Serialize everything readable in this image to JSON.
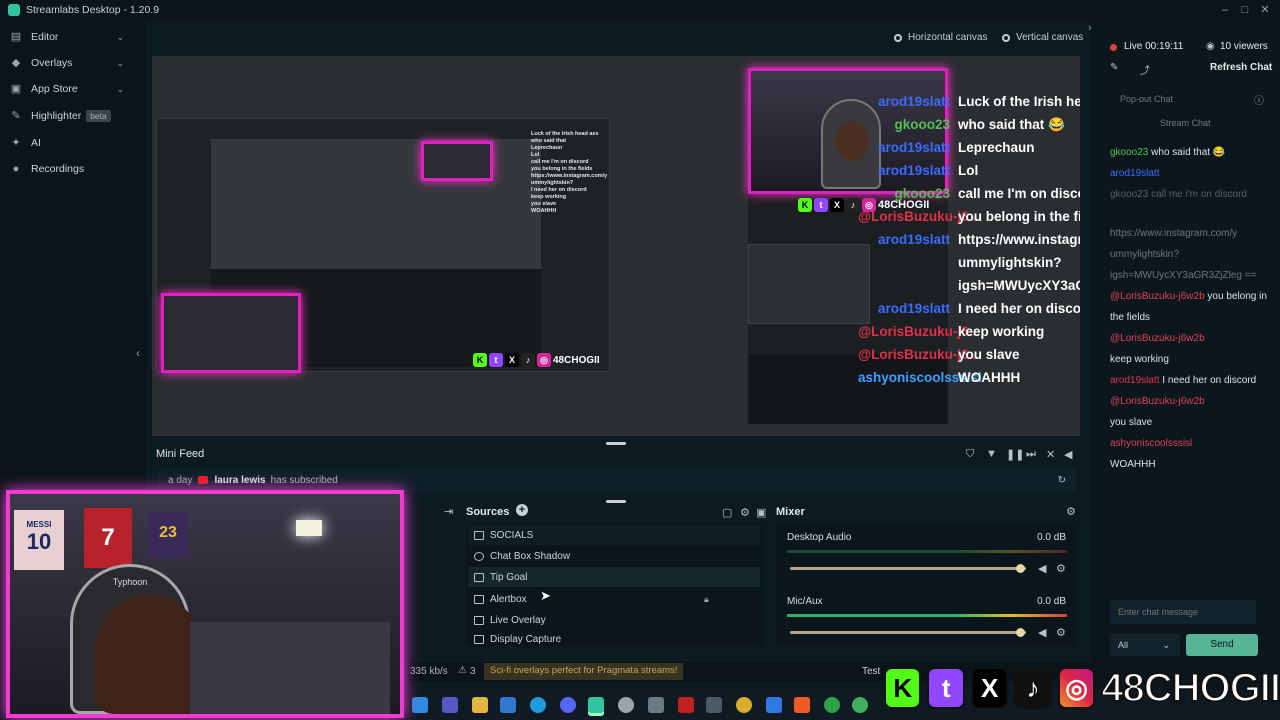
{
  "app": {
    "title": "Streamlabs Desktop - 1.20.9"
  },
  "sidebar": {
    "items": [
      {
        "label": "Editor",
        "icon": "editor-icon",
        "chevron": "⌄"
      },
      {
        "label": "Overlays",
        "icon": "overlays-icon",
        "chevron": "⌄"
      },
      {
        "label": "App Store",
        "icon": "app-store-icon",
        "chevron": "⌄"
      },
      {
        "label": "Highlighter",
        "icon": "highlighter-icon",
        "badge": "beta"
      },
      {
        "label": "AI",
        "icon": "ai-icon"
      },
      {
        "label": "Recordings",
        "icon": "recordings-icon"
      }
    ]
  },
  "canvas": {
    "horizontal": "Horizontal canvas",
    "vertical": "Vertical canvas"
  },
  "overlay_chat": [
    {
      "name": "arod19slatt",
      "color": "#3a6cff",
      "text": "Luck of the Irish head ass"
    },
    {
      "name": "gkooo23",
      "color": "#4fc24f",
      "text": "who said that 😂"
    },
    {
      "name": "arod19slatt",
      "color": "#3a6cff",
      "text": "Leprechaun"
    },
    {
      "name": "arod19slatt",
      "color": "#3a6cff",
      "text": "Lol"
    },
    {
      "name": "gkooo23",
      "color": "#4fc24f",
      "text": "call me I'm on discord"
    },
    {
      "name": "@LorisBuzuku-j6...",
      "color": "#e0304a",
      "text": "you belong in the fields"
    },
    {
      "name": "arod19slatt",
      "color": "#3a6cff",
      "text": "https://www.instagram.com/y"
    },
    {
      "name": "",
      "color": "#3a6cff",
      "text": "ummylightskin?"
    },
    {
      "name": "",
      "color": "#3a6cff",
      "text": "igsh=MWUycXY3aGR3ZjZleg=="
    },
    {
      "name": "arod19slatt",
      "color": "#3a6cff",
      "text": "I need her on discord"
    },
    {
      "name": "@LorisBuzuku-j6...",
      "color": "#e0304a",
      "text": "keep working"
    },
    {
      "name": "@LorisBuzuku-j6...",
      "color": "#e0304a",
      "text": "you slave"
    },
    {
      "name": "ashyoniscoolsssisl",
      "color": "#3aa0ff",
      "text": "WOAHHH"
    }
  ],
  "overlay_social": {
    "handle": "48CHOGII"
  },
  "minifeed": {
    "title": "Mini Feed",
    "time": "a day",
    "user": "laura lewis",
    "action": "has subscribed"
  },
  "sources": {
    "title": "Sources",
    "items": [
      "SOCIALS",
      "Chat Box Shadow",
      "Tip Goal",
      "Alertbox",
      "Live Overlay",
      "Display Capture"
    ]
  },
  "mixer": {
    "title": "Mixer",
    "channels": [
      {
        "name": "Desktop Audio",
        "db": "0.0 dB",
        "level": 0.82
      },
      {
        "name": "Mic/Aux",
        "db": "0.0 dB",
        "level": 0.82
      }
    ]
  },
  "status": {
    "bitrate": "335 kb/s",
    "warnings": "3",
    "promo": "Sci-fi overlays perfect for Pragmata streams!",
    "test": "Test"
  },
  "chat": {
    "live": "Live 00:19:11",
    "viewers": "10 viewers",
    "refresh": "Refresh Chat",
    "popout": "Pop-out Chat",
    "stream_chat": "Stream Chat",
    "messages": [
      {
        "name": "gkooo23",
        "text": "who said that 😂"
      },
      {
        "name": "arod19slatt",
        "text": ""
      },
      {
        "name": "gkooo23",
        "text": "call me i'm on discord"
      },
      {
        "name": "",
        "text": "https://www.instagram.com/y ummylightskin? igsh=MWUycXY3aGR3ZjZleg =="
      },
      {
        "name": "@LorisBuzuku-j6w2b",
        "text": "you belong in the fields"
      },
      {
        "name": "@LorisBuzuku-j6w2b",
        "text": "keep working"
      },
      {
        "name": "arod19slatt",
        "text": "I need her on discord"
      },
      {
        "name": "@LorisBuzuku-j6w2b",
        "text": "you slave"
      },
      {
        "name": "ashyoniscoolsssisl",
        "text": "WOAHHH"
      }
    ],
    "input_placeholder": "Enter chat message",
    "select": "All",
    "send": "Send"
  },
  "webcam": {
    "jersey1": "MESSI",
    "jersey1_num": "10",
    "jersey2": "7",
    "jersey3": "23",
    "chair_brand": "Typhoon"
  },
  "colors": {
    "accent": "#31c3a2",
    "pink": "#f03cd0"
  }
}
